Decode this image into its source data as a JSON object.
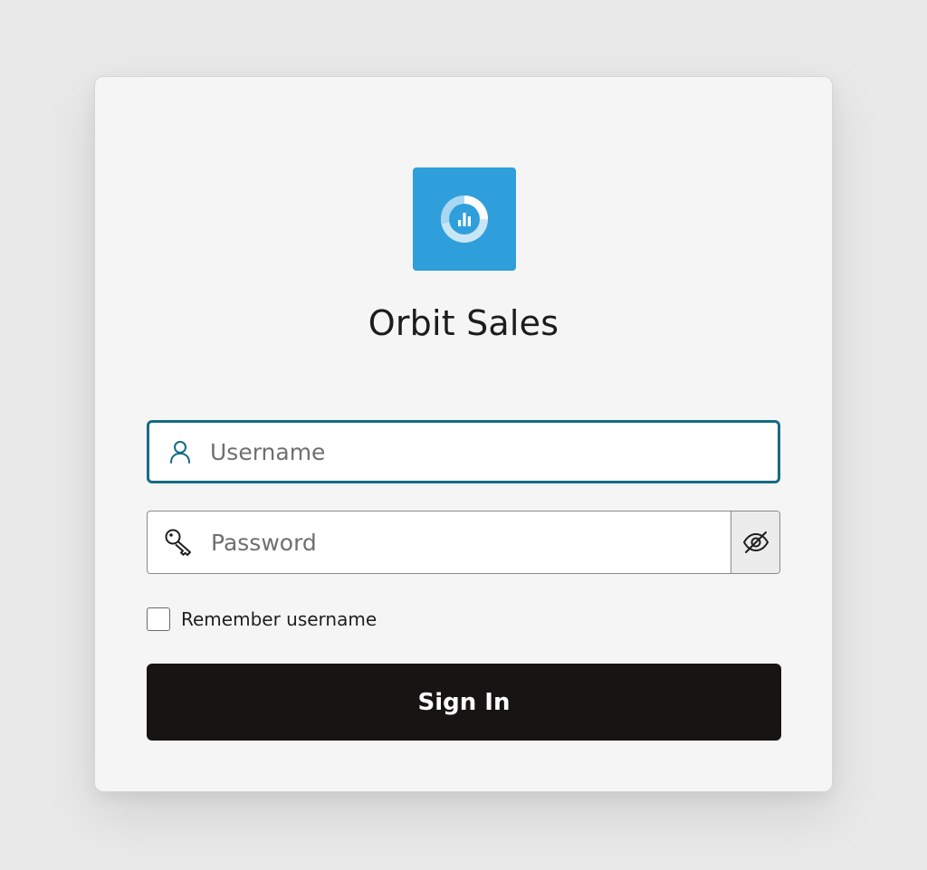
{
  "app": {
    "title": "Orbit Sales",
    "brand_color": "#2f9fdc",
    "logo_icon": "donut-chart-icon"
  },
  "form": {
    "username": {
      "placeholder": "Username",
      "value": "",
      "icon": "user-icon",
      "focused": true,
      "focus_color": "#156b84"
    },
    "password": {
      "placeholder": "Password",
      "value": "",
      "icon": "key-icon",
      "toggle_icon": "eye-slash-icon"
    },
    "remember": {
      "label": "Remember username",
      "checked": false
    },
    "submit": {
      "label": "Sign In",
      "color": "#171514"
    }
  }
}
